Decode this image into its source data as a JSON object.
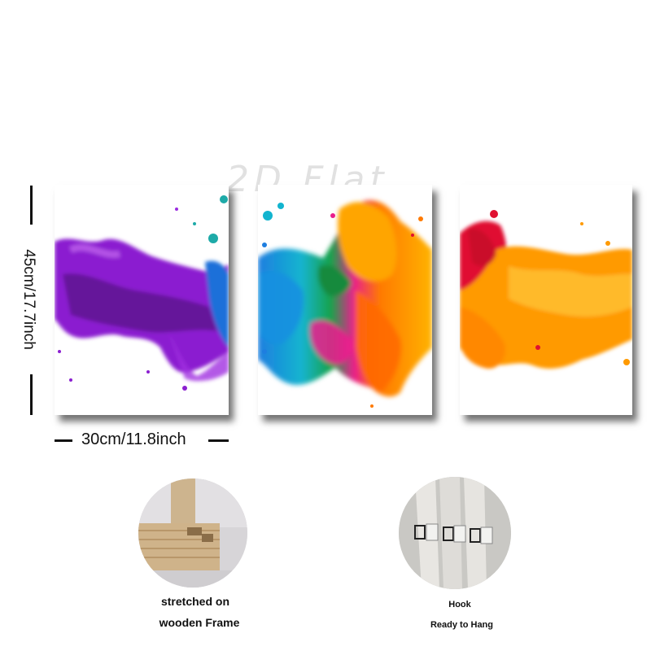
{
  "watermark": "2D Flat",
  "dimensions": {
    "height_label": "45cm/17.7inch",
    "width_label": "30cm/11.8inch"
  },
  "panels": [
    {
      "name": "panel-left",
      "colors": [
        "#8b1fd0",
        "#6a1a9e",
        "#b23ae8",
        "#1e6fd9"
      ]
    },
    {
      "name": "panel-center",
      "colors": [
        "#1aa6d6",
        "#e91e8c",
        "#ff9900",
        "#1fa84a"
      ]
    },
    {
      "name": "panel-right",
      "colors": [
        "#e01030",
        "#ff9a00",
        "#ffb820"
      ]
    }
  ],
  "features": {
    "frame": {
      "line1": "stretched on",
      "line2": "wooden Frame"
    },
    "hook": {
      "line1": "Hook",
      "line2": "Ready to Hang"
    }
  }
}
